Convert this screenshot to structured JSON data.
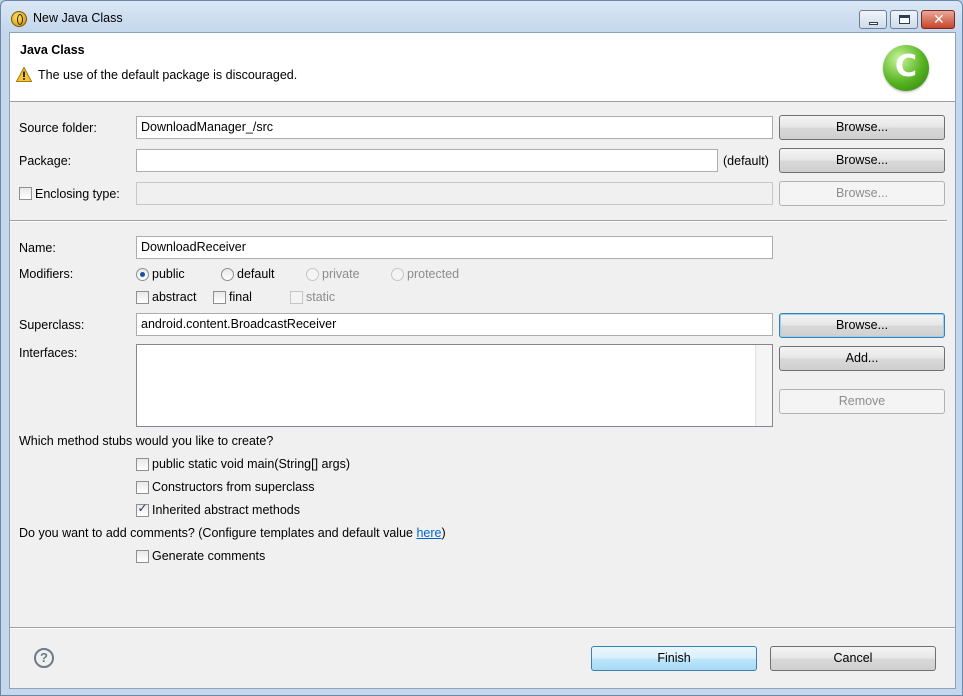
{
  "window": {
    "title": "New Java Class"
  },
  "header": {
    "title": "Java Class",
    "message": "The use of the default package is discouraged.",
    "logo_letter": "C"
  },
  "form": {
    "source_folder": {
      "label": "Source folder:",
      "value": "DownloadManager_/src",
      "button": "Browse..."
    },
    "package": {
      "label": "Package:",
      "value": "",
      "suffix": "(default)",
      "button": "Browse..."
    },
    "enclosing_type": {
      "label": "Enclosing type:",
      "checked": false,
      "value": "",
      "button": "Browse..."
    },
    "name": {
      "label": "Name:",
      "value": "DownloadReceiver"
    },
    "modifiers": {
      "label": "Modifiers:",
      "access": [
        {
          "label": "public",
          "selected": true,
          "enabled": true
        },
        {
          "label": "default",
          "selected": false,
          "enabled": true
        },
        {
          "label": "private",
          "selected": false,
          "enabled": false
        },
        {
          "label": "protected",
          "selected": false,
          "enabled": false
        }
      ],
      "flags": [
        {
          "label": "abstract",
          "checked": false,
          "enabled": true
        },
        {
          "label": "final",
          "checked": false,
          "enabled": true
        },
        {
          "label": "static",
          "checked": false,
          "enabled": false
        }
      ]
    },
    "superclass": {
      "label": "Superclass:",
      "value": "android.content.BroadcastReceiver",
      "button": "Browse..."
    },
    "interfaces": {
      "label": "Interfaces:",
      "items": [],
      "add_button": "Add...",
      "remove_button": "Remove"
    },
    "stubs": {
      "question": "Which method stubs would you like to create?",
      "options": [
        {
          "label": "public static void main(String[] args)",
          "checked": false
        },
        {
          "label": "Constructors from superclass",
          "checked": false
        },
        {
          "label": "Inherited abstract methods",
          "checked": true
        }
      ]
    },
    "comments": {
      "question": "Do you want to add comments? (Configure templates and default value ",
      "link": "here",
      "question_end": ")",
      "option": {
        "label": "Generate comments",
        "checked": false
      }
    }
  },
  "footer": {
    "help_icon": "?",
    "finish": "Finish",
    "cancel": "Cancel"
  },
  "icons": [
    "app-icon",
    "minimize-icon",
    "maximize-icon",
    "close-icon",
    "warning-icon",
    "java-class-logo",
    "help-icon"
  ]
}
